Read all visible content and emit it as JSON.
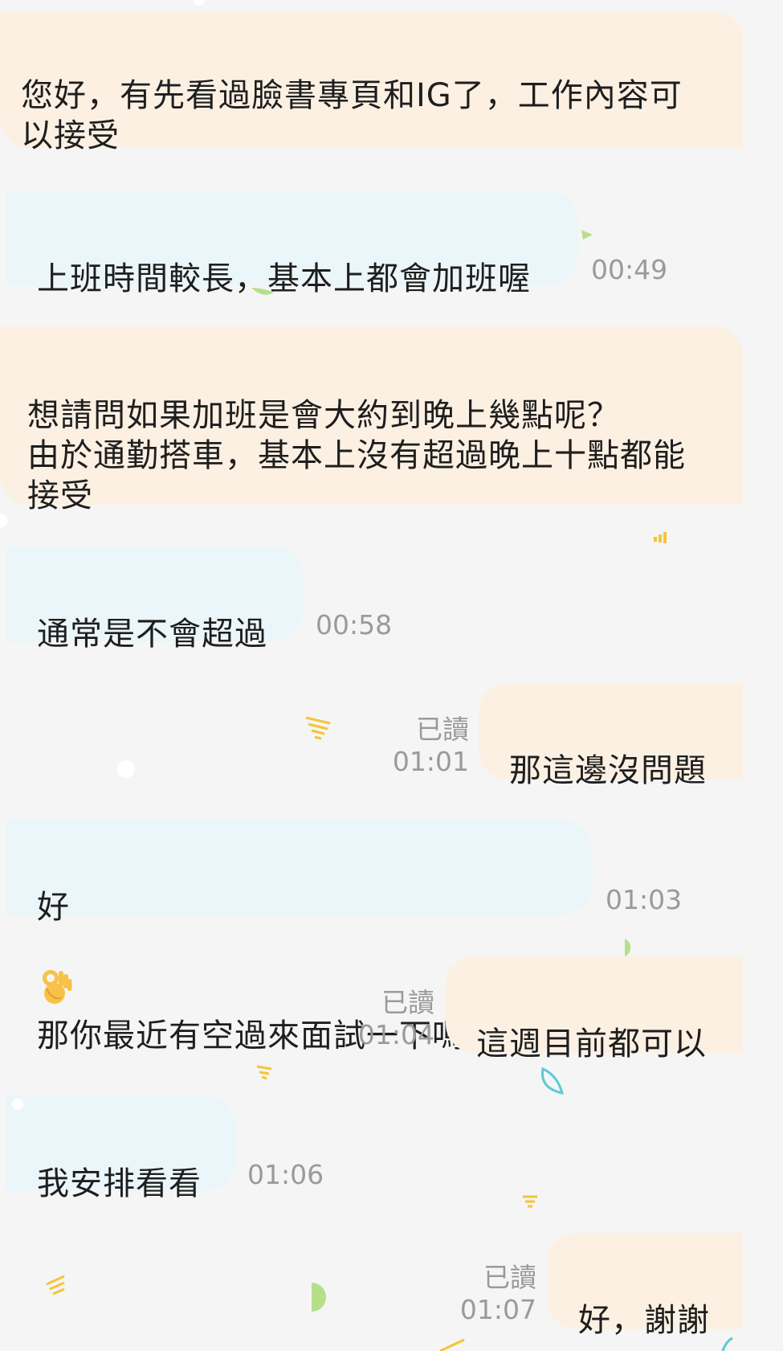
{
  "messages": [
    {
      "id": "m1",
      "side": "out",
      "text": "您好，有先看過臉書專頁和IG了，工作內容可\n以接受"
    },
    {
      "id": "m2",
      "side": "in",
      "text": "上班時間較長，基本上都會加班喔",
      "time": "00:49"
    },
    {
      "id": "m3",
      "side": "out",
      "text": "想請問如果加班是會大約到晚上幾點呢？\n由於通勤搭車，基本上沒有超過晚上十點都能\n接受"
    },
    {
      "id": "m4",
      "side": "in",
      "text": "通常是不會超過",
      "time": "00:58"
    },
    {
      "id": "m5",
      "side": "out",
      "text": "那這邊沒問題",
      "read": "已讀",
      "time": "01:01"
    },
    {
      "id": "m6",
      "side": "in",
      "text_before": "好",
      "emoji": "ok-hand-emoji",
      "text_after": "那你最近有空過來面試一下嗎",
      "time": "01:03"
    },
    {
      "id": "m7",
      "side": "out",
      "text": "這週目前都可以",
      "read": "已讀",
      "time": "01:04"
    },
    {
      "id": "m8",
      "side": "in",
      "text": "我安排看看",
      "time": "01:06"
    },
    {
      "id": "m9",
      "side": "out",
      "text": "好，謝謝",
      "read": "已讀",
      "time": "01:07"
    }
  ],
  "colors": {
    "background": "#f5f5f5",
    "outgoing_bubble": "#fcf0e3",
    "incoming_bubble": "#eaf6f9",
    "meta_text": "#9a9a9a",
    "confetti_green": "#b5e08a",
    "confetti_yellow": "#f4c534",
    "confetti_teal": "#5ccad6"
  }
}
